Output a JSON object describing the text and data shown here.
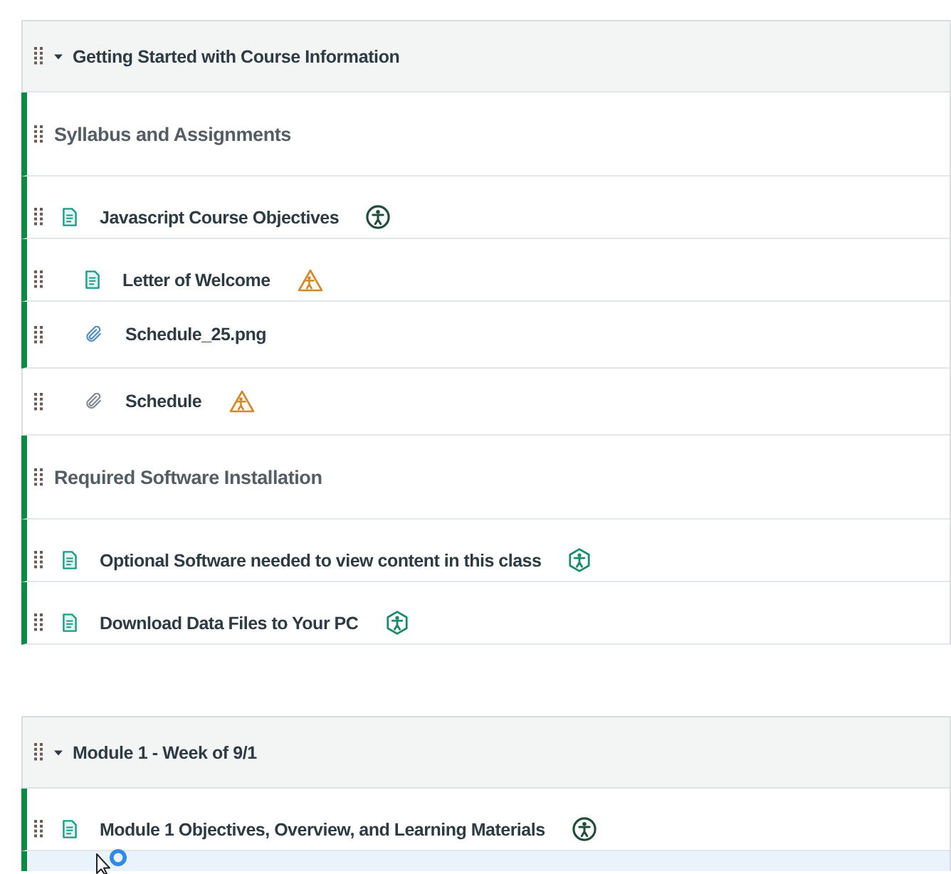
{
  "modules": [
    {
      "title": "Getting Started with Course Information",
      "expanded": true,
      "items": [
        {
          "kind": "subheader",
          "title": "Syllabus and Assignments",
          "published": true,
          "highlighted": false
        },
        {
          "kind": "page",
          "title": "Javascript Course Objectives",
          "published": true,
          "highlighted": false,
          "accessibility_badge": {
            "kind": "circle"
          },
          "children": [
            {
              "kind": "page",
              "title": "Letter of Welcome",
              "published": true,
              "highlighted": false,
              "accessibility_badge": {
                "kind": "triangle"
              }
            },
            {
              "kind": "attachment",
              "title": "Schedule_25.png",
              "published": true,
              "highlighted": false
            },
            {
              "kind": "attachment",
              "title": "Schedule",
              "published": false,
              "highlighted": false,
              "accessibility_badge": {
                "kind": "triangle"
              }
            }
          ]
        },
        {
          "kind": "subheader",
          "title": "Required Software Installation",
          "published": true,
          "highlighted": false
        },
        {
          "kind": "page",
          "title": "Optional Software needed to view content in this class",
          "published": true,
          "highlighted": false,
          "accessibility_badge": {
            "kind": "hexagon"
          }
        },
        {
          "kind": "page",
          "title": "Download Data Files to Your PC",
          "published": true,
          "highlighted": false,
          "accessibility_badge": {
            "kind": "hexagon"
          }
        }
      ]
    },
    {
      "title": "Module 1 - Week of 9/1",
      "expanded": true,
      "items": [
        {
          "kind": "page",
          "title": "Module 1 Objectives, Overview, and Learning Materials",
          "published": true,
          "highlighted": false,
          "accessibility_badge": {
            "kind": "circle"
          }
        },
        {
          "kind": "cut_off",
          "published": true,
          "highlighted": true
        }
      ]
    }
  ]
}
